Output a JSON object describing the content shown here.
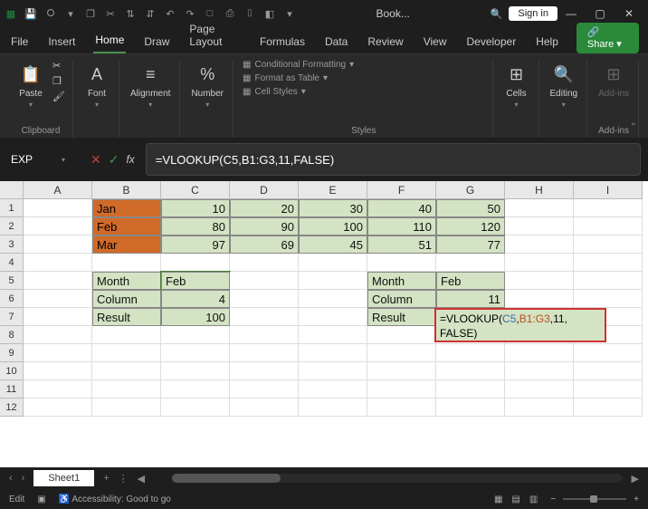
{
  "titlebar": {
    "title": "Book...",
    "signin": "Sign in"
  },
  "tabs": {
    "file": "File",
    "insert": "Insert",
    "home": "Home",
    "draw": "Draw",
    "pagelayout": "Page Layout",
    "formulas": "Formulas",
    "data": "Data",
    "review": "Review",
    "view": "View",
    "developer": "Developer",
    "help": "Help",
    "share": "Share"
  },
  "ribbon": {
    "clipboard": {
      "paste": "Paste",
      "label": "Clipboard"
    },
    "font": {
      "btn": "Font"
    },
    "alignment": {
      "btn": "Alignment"
    },
    "number": {
      "btn": "Number"
    },
    "styles": {
      "cond": "Conditional Formatting",
      "table": "Format as Table",
      "cell": "Cell Styles",
      "label": "Styles"
    },
    "cells": {
      "btn": "Cells"
    },
    "editing": {
      "btn": "Editing"
    },
    "addins": {
      "btn": "Add-ins",
      "label": "Add-ins"
    }
  },
  "namebox": "EXP",
  "formula": "=VLOOKUP(C5,B1:G3,11,FALSE)",
  "columns": [
    "A",
    "B",
    "C",
    "D",
    "E",
    "F",
    "G",
    "H",
    "I"
  ],
  "rows": [
    "1",
    "2",
    "3",
    "4",
    "5",
    "6",
    "7",
    "8",
    "9",
    "10",
    "11",
    "12"
  ],
  "sheetdata": {
    "r1": {
      "B": "Jan",
      "C": "10",
      "D": "20",
      "E": "30",
      "F": "40",
      "G": "50"
    },
    "r2": {
      "B": "Feb",
      "C": "80",
      "D": "90",
      "E": "100",
      "F": "110",
      "G": "120"
    },
    "r3": {
      "B": "Mar",
      "C": "97",
      "D": "69",
      "E": "45",
      "F": "51",
      "G": "77"
    },
    "r5": {
      "B": "Month",
      "C": "Feb",
      "F": "Month",
      "G": "Feb"
    },
    "r6": {
      "B": "Column",
      "C": "4",
      "F": "Column",
      "G": "11"
    },
    "r7": {
      "B": "Result",
      "C": "100",
      "F": "Result"
    }
  },
  "overlay": {
    "pre": "=VLOOKUP(",
    "a1": "C5",
    "c1": ",",
    "a2": "B1:G3",
    "c2": ",11,",
    "post": "FALSE)"
  },
  "sheet": {
    "name": "Sheet1",
    "add": "+"
  },
  "status": {
    "mode": "Edit",
    "acc": "Accessibility: Good to go",
    "zoom_minus": "−",
    "zoom_plus": "+"
  }
}
